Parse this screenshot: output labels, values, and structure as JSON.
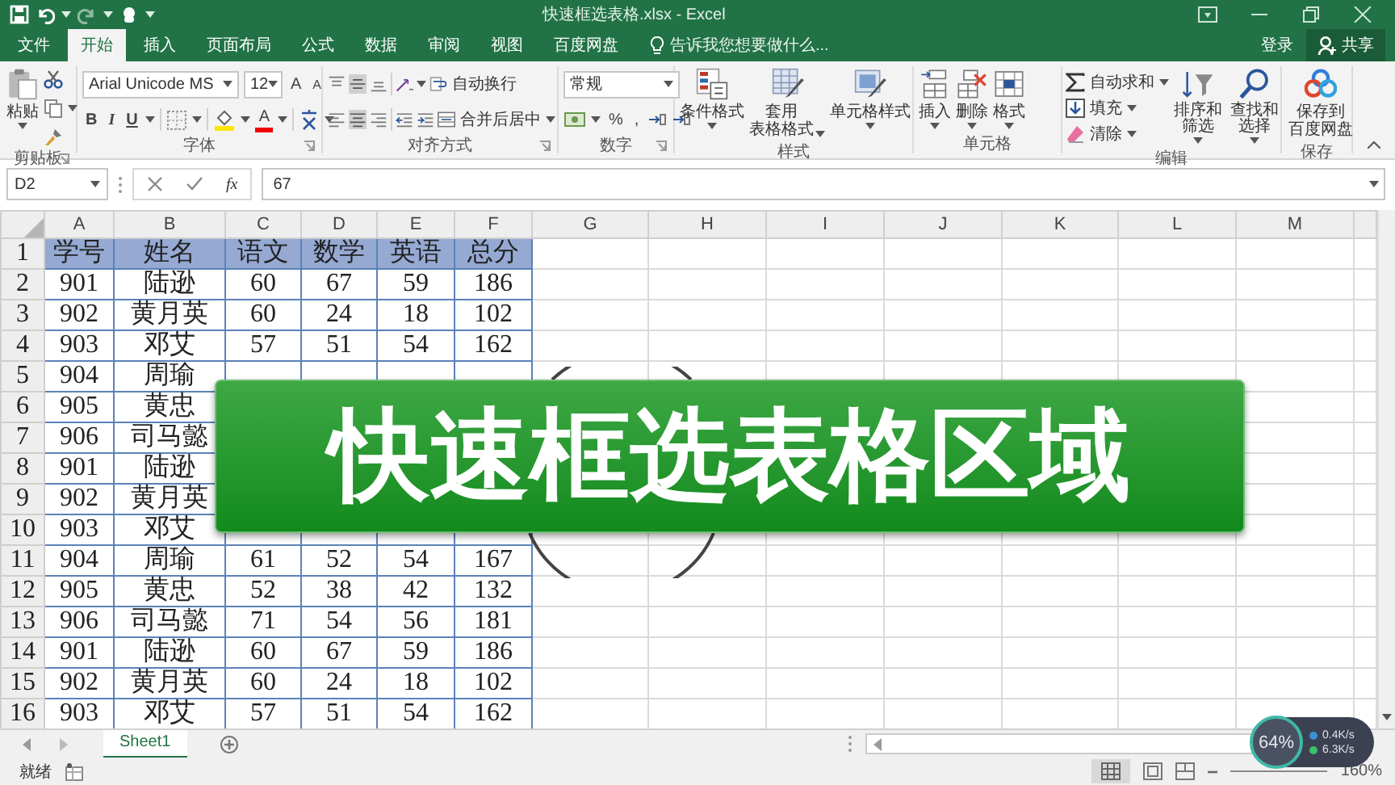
{
  "window": {
    "title": "快速框选表格.xlsx - Excel"
  },
  "tabs": [
    {
      "label": "文件",
      "selected": false
    },
    {
      "label": "开始",
      "selected": true
    },
    {
      "label": "插入",
      "selected": false
    },
    {
      "label": "页面布局",
      "selected": false
    },
    {
      "label": "公式",
      "selected": false
    },
    {
      "label": "数据",
      "selected": false
    },
    {
      "label": "审阅",
      "selected": false
    },
    {
      "label": "视图",
      "selected": false
    },
    {
      "label": "百度网盘",
      "selected": false
    }
  ],
  "tell_me": {
    "placeholder": "告诉我您想要做什么..."
  },
  "account": {
    "sign_in": "登录",
    "share": "共享"
  },
  "ribbon": {
    "clipboard": {
      "label": "剪贴板",
      "paste": "粘贴"
    },
    "font": {
      "label": "字体",
      "font_name": "Arial Unicode MS",
      "font_size": "12",
      "grow": "A",
      "shrink": "A",
      "bold": "B",
      "italic": "I",
      "underline": "U",
      "font_color": "A"
    },
    "alignment": {
      "label": "对齐方式",
      "wrap_text": "自动换行",
      "merge_center": "合并后居中"
    },
    "number": {
      "label": "数字",
      "format": "常规",
      "percent": "%",
      "comma": ","
    },
    "styles": {
      "label": "样式",
      "conditional": [
        "条件格式"
      ],
      "table_format": [
        "套用",
        "表格格式"
      ],
      "cell_style": [
        "单元格样式"
      ]
    },
    "cells": {
      "label": "单元格",
      "insert": [
        "插入"
      ],
      "delete": [
        "删除"
      ],
      "format": [
        "格式"
      ]
    },
    "editing": {
      "label": "编辑",
      "autosum": "自动求和",
      "fill": "填充",
      "clear": "清除",
      "sort_filter": [
        "排序和筛选"
      ],
      "find_select": [
        "查找和选择"
      ]
    },
    "save": {
      "label": "保存",
      "button": [
        "保存到",
        "百度网盘"
      ]
    }
  },
  "formula_bar": {
    "name_box": "D2",
    "function_button": "fx",
    "formula": "67"
  },
  "sheet": {
    "columns": [
      "A",
      "B",
      "C",
      "D",
      "E",
      "F",
      "G",
      "H",
      "I",
      "J",
      "K",
      "L",
      "M"
    ],
    "rows": [
      {
        "number": "1",
        "header": true,
        "cells": [
          "学号",
          "姓名",
          "语文",
          "数学",
          "英语",
          "总分"
        ]
      },
      {
        "number": "2",
        "header": false,
        "cells": [
          "901",
          "陆逊",
          "60",
          "67",
          "59",
          "186"
        ]
      },
      {
        "number": "3",
        "header": false,
        "cells": [
          "902",
          "黄月英",
          "60",
          "24",
          "18",
          "102"
        ]
      },
      {
        "number": "4",
        "header": false,
        "cells": [
          "903",
          "邓艾",
          "57",
          "51",
          "54",
          "162"
        ]
      },
      {
        "number": "5",
        "header": false,
        "cells": [
          "904",
          "周瑜"
        ]
      },
      {
        "number": "6",
        "header": false,
        "cells": [
          "905",
          "黄忠"
        ]
      },
      {
        "number": "7",
        "header": false,
        "cells": [
          "906",
          "司马懿"
        ]
      },
      {
        "number": "8",
        "header": false,
        "cells": [
          "901",
          "陆逊"
        ]
      },
      {
        "number": "9",
        "header": false,
        "cells": [
          "902",
          "黄月英"
        ]
      },
      {
        "number": "10",
        "header": false,
        "cells": [
          "903",
          "邓艾"
        ]
      },
      {
        "number": "11",
        "header": false,
        "cells": [
          "904",
          "周瑜",
          "61",
          "52",
          "54",
          "167"
        ]
      },
      {
        "number": "12",
        "header": false,
        "cells": [
          "905",
          "黄忠",
          "52",
          "38",
          "42",
          "132"
        ]
      },
      {
        "number": "13",
        "header": false,
        "cells": [
          "906",
          "司马懿",
          "71",
          "54",
          "56",
          "181"
        ]
      },
      {
        "number": "14",
        "header": false,
        "cells": [
          "901",
          "陆逊",
          "60",
          "67",
          "59",
          "186"
        ]
      },
      {
        "number": "15",
        "header": false,
        "cells": [
          "902",
          "黄月英",
          "60",
          "24",
          "18",
          "102"
        ]
      },
      {
        "number": "16",
        "header": false,
        "cells": [
          "903",
          "邓艾",
          "57",
          "51",
          "54",
          "162"
        ]
      }
    ]
  },
  "sheet_tabs": [
    {
      "label": "Sheet1",
      "selected": true
    }
  ],
  "status_bar": {
    "status": "就绪",
    "zoom": "160%"
  },
  "banner": {
    "text": "快速框选表格区域"
  },
  "speed_widget": {
    "usage": "64%",
    "upload": "0.4K/s",
    "download": "6.3K/s"
  }
}
